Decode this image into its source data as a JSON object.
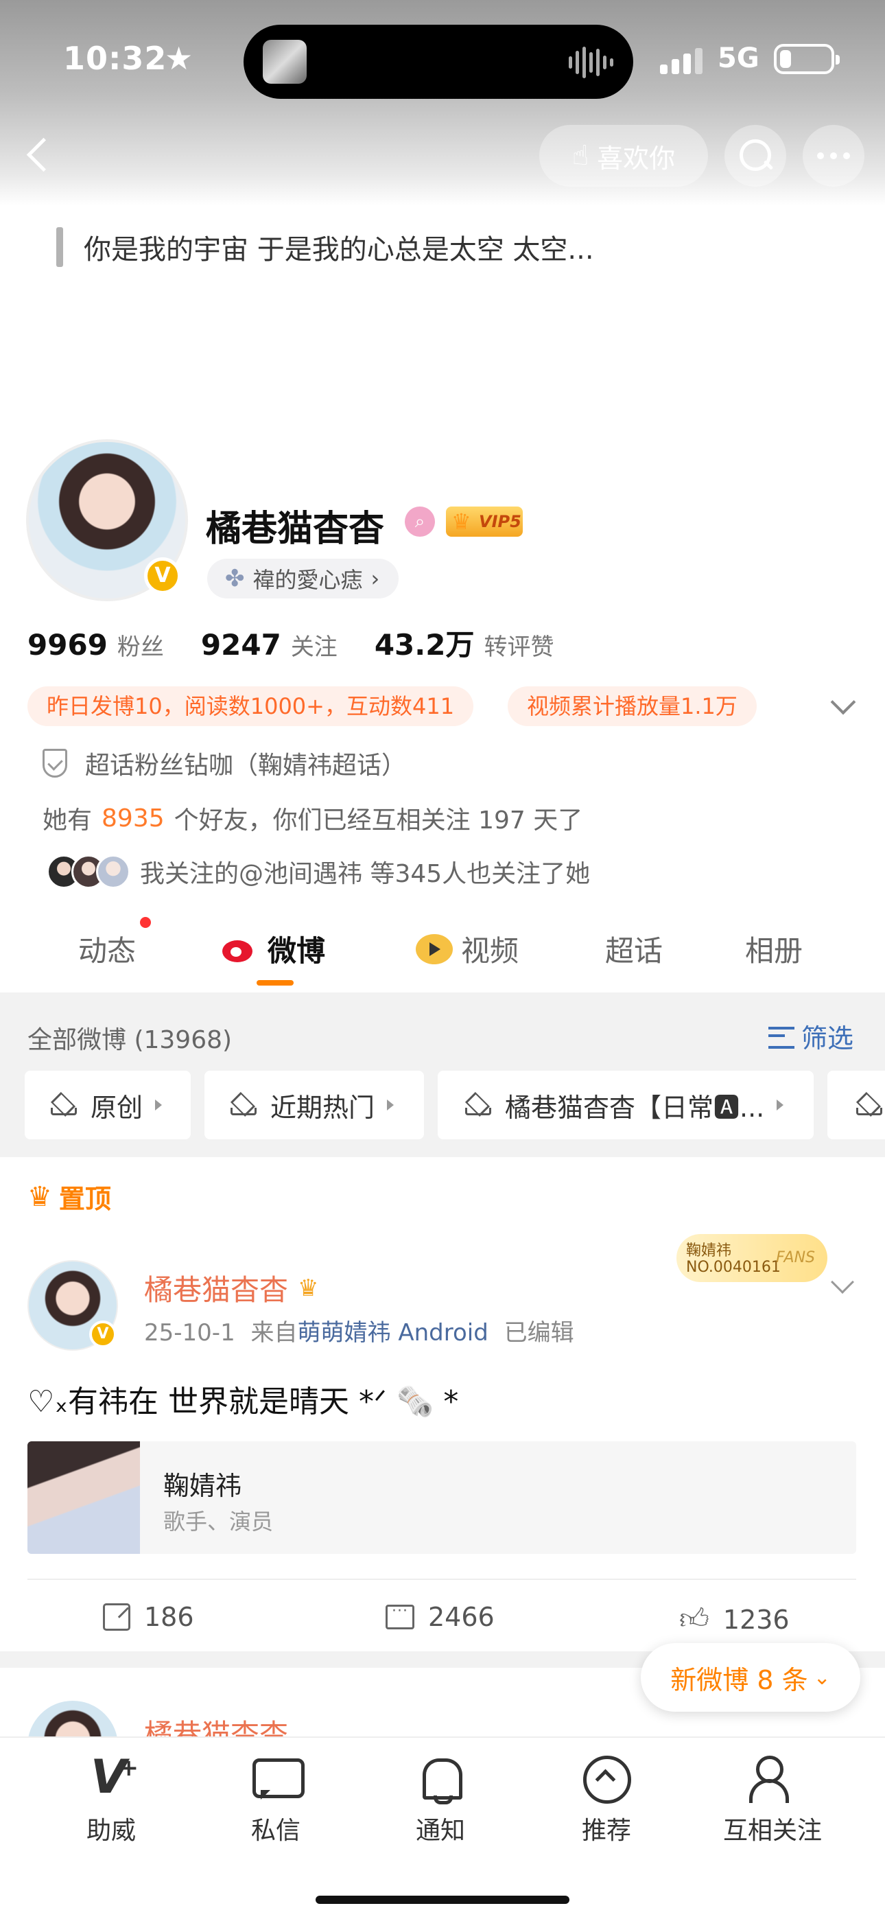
{
  "status_bar": {
    "time": "10:32",
    "network": "5G"
  },
  "header": {
    "like_label": "喜欢你"
  },
  "profile": {
    "signature": "你是我的宇宙 于是我的心总是太空 太空...",
    "name": "橘巷猫杳杳",
    "vip": "VIP5",
    "verified_mark": "V",
    "group": "禕的愛心痣",
    "stats": [
      {
        "num": "9969",
        "label": "粉丝"
      },
      {
        "num": "9247",
        "label": "关注"
      },
      {
        "num": "43.2万",
        "label": "转评赞"
      }
    ],
    "tags": [
      "昨日发博10，阅读数1000+，互动数411",
      "视频累计播放量1.1万"
    ],
    "super_topic": "超话粉丝钻咖（鞠婧祎超话）",
    "friends": {
      "prefix": "她有",
      "count": "8935",
      "suffix": "个好友，你们已经互相关注 197 天了"
    },
    "followed_by": "我关注的@池间遇祎 等345人也关注了她"
  },
  "tabs": [
    "动态",
    "微博",
    "视频",
    "超话",
    "相册"
  ],
  "filter": {
    "all_label": "全部微博 (13968)",
    "filter_label": "筛选",
    "chips": [
      "原创",
      "近期热门",
      "橘巷猫杳杳【日常🅰..."
    ]
  },
  "post": {
    "pinned_label": "置顶",
    "author": "橘巷猫杳杳",
    "date": "25-10-1",
    "from_label": "来自",
    "source": "萌萌婧祎 Android",
    "edited": "已编辑",
    "fan_badge": {
      "name": "鞠婧祎",
      "number": "NO.0040161",
      "fans": "FANS"
    },
    "text": "♡ₓ有祎在 世界就是晴天 *ᐟ 🗞️ *",
    "card": {
      "name": "鞠婧祎",
      "desc": "歌手、演员"
    },
    "reposts": "186",
    "comments": "2466",
    "likes": "1236"
  },
  "new_posts_label": "新微博 8 条",
  "next_post_author": "橘巷猫杳杳",
  "bottom_nav": [
    "助威",
    "私信",
    "通知",
    "推荐",
    "互相关注"
  ]
}
